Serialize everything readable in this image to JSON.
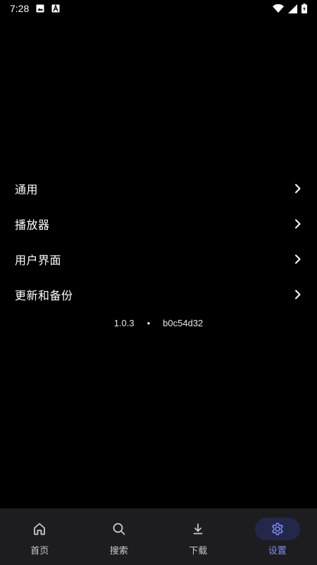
{
  "status_bar": {
    "time": "7:28",
    "icons": [
      "image-icon",
      "font-a-icon",
      "wifi-icon",
      "signal-icon",
      "battery-charging-icon"
    ]
  },
  "menu": {
    "items": [
      {
        "label": "通用",
        "icon": "chevron-right-icon"
      },
      {
        "label": "播放器",
        "icon": "chevron-right-icon"
      },
      {
        "label": "用户界面",
        "icon": "chevron-right-icon"
      },
      {
        "label": "更新和备份",
        "icon": "chevron-right-icon"
      }
    ]
  },
  "version": {
    "number": "1.0.3",
    "separator": "•",
    "commit": "b0c54d32"
  },
  "bottom_nav": {
    "items": [
      {
        "label": "首页",
        "icon": "home-icon",
        "active": false
      },
      {
        "label": "搜索",
        "icon": "search-icon",
        "active": false
      },
      {
        "label": "下载",
        "icon": "download-icon",
        "active": false
      },
      {
        "label": "设置",
        "icon": "gear-icon",
        "active": true
      }
    ],
    "active_color": "#7e8cf2",
    "active_bg": "#23284a"
  }
}
